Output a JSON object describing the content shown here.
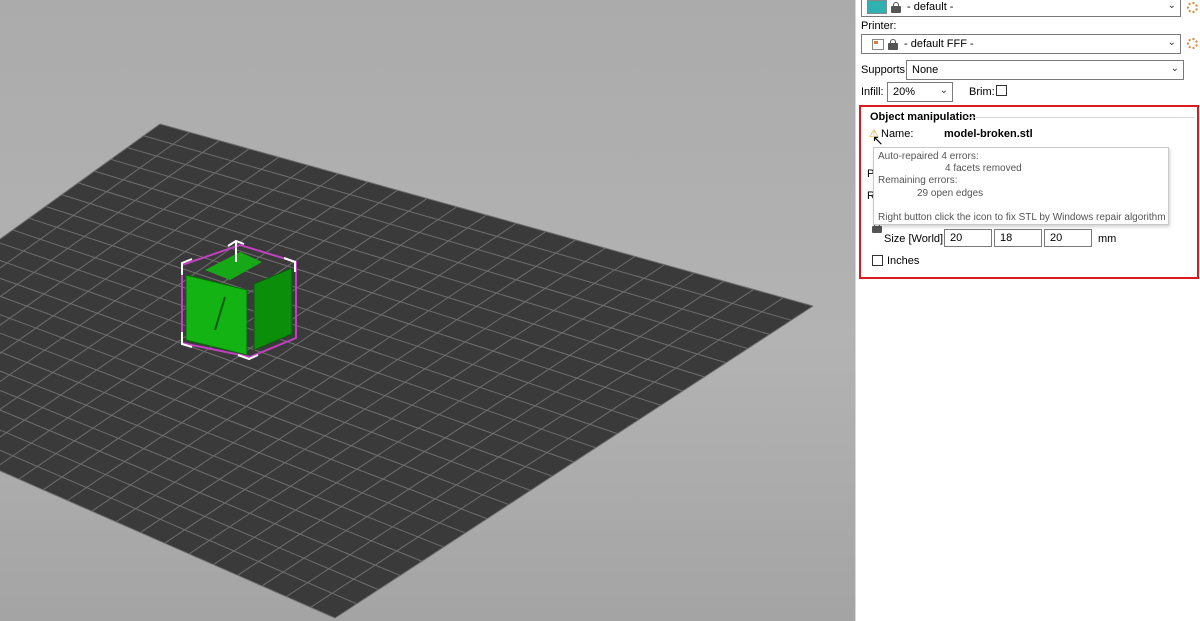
{
  "filament": {
    "value": "- default -",
    "color": "#2fb1b1"
  },
  "printer": {
    "label": "Printer:",
    "value": "- default FFF -"
  },
  "supports": {
    "label": "Supports:",
    "value": "None"
  },
  "infill": {
    "label": "Infill:",
    "value": "20%"
  },
  "brim": {
    "label": "Brim:",
    "checked": false
  },
  "object_manipulation": {
    "title": "Object manipulation",
    "name_label": "Name:",
    "name_value": "model-broken.stl",
    "partial_labels": [
      "P",
      "R"
    ],
    "size_label": "Size [World]:",
    "size": [
      "20",
      "18",
      "20"
    ],
    "unit": "mm",
    "inches_label": "Inches",
    "inches_checked": false,
    "highlight_color": "#e0191f"
  },
  "tooltip": {
    "line1": "Auto-repaired 4 errors:",
    "line2": "4 facets removed",
    "line3": "Remaining errors:",
    "line4": "29 open edges",
    "line5": "Right button click the icon to fix STL by Windows repair algorithm"
  },
  "colors": {
    "model": "#1bb31b",
    "bed": "#3a3a3a",
    "selection": "#c040c0"
  }
}
